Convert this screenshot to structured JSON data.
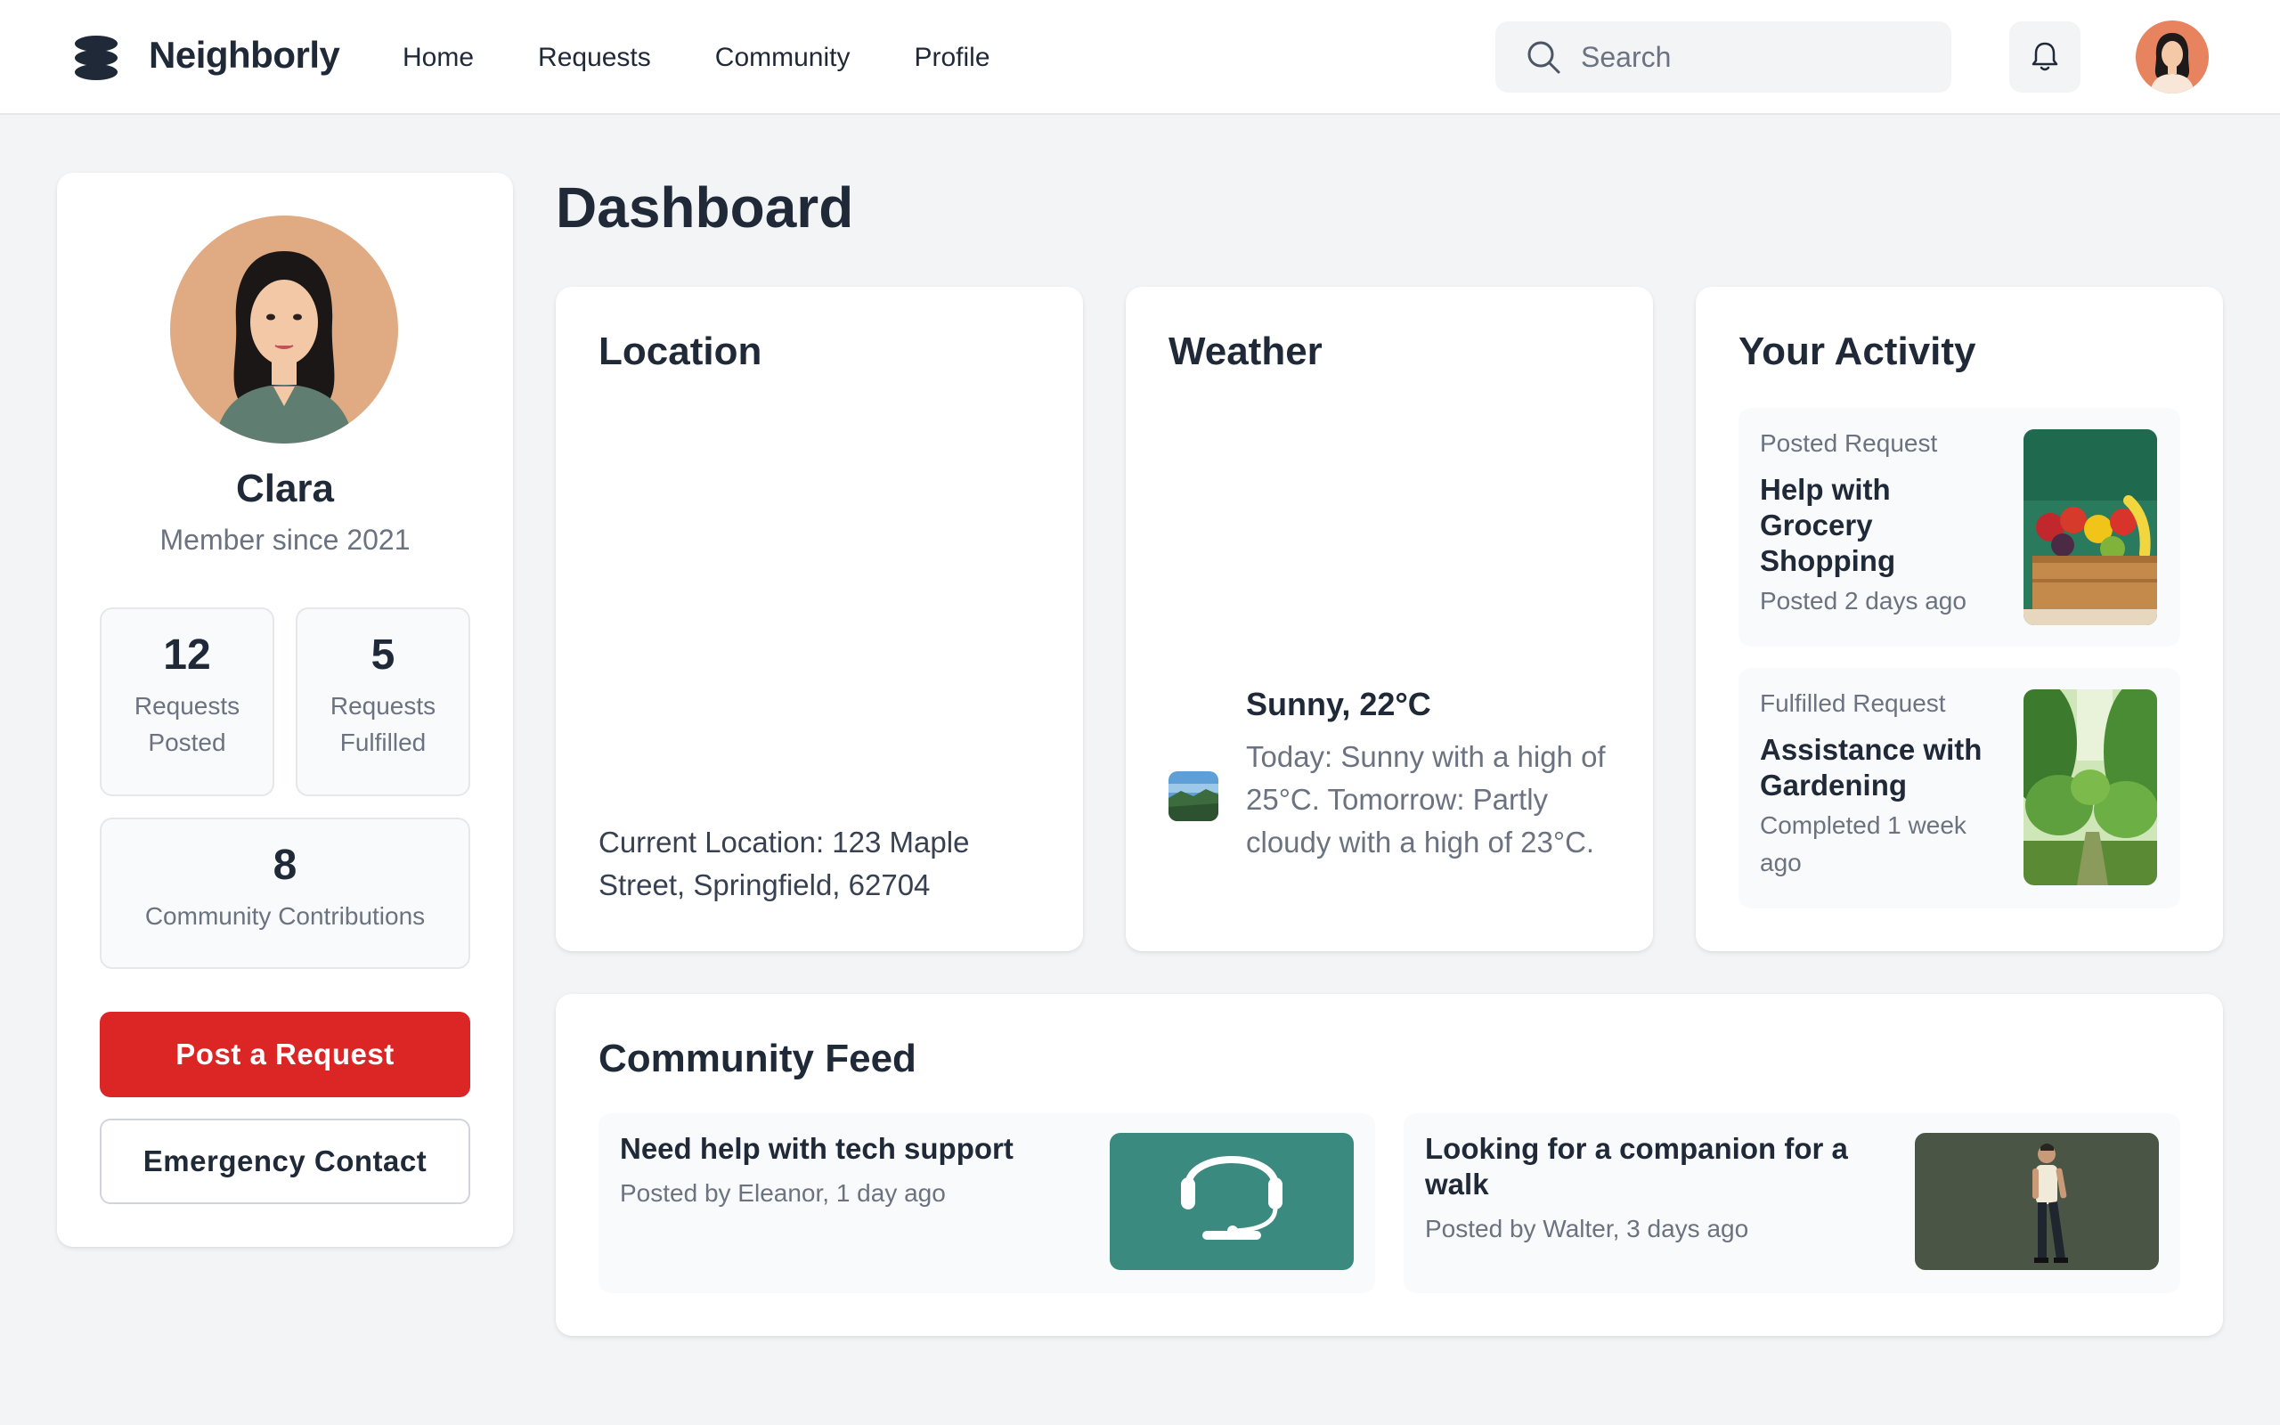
{
  "header": {
    "brand": "Neighborly",
    "nav": [
      "Home",
      "Requests",
      "Community",
      "Profile"
    ],
    "search_placeholder": "Search"
  },
  "profile": {
    "name": "Clara",
    "member_since": "Member since 2021",
    "stats": [
      {
        "value": "12",
        "label": "Requests Posted"
      },
      {
        "value": "5",
        "label": "Requests Fulfilled"
      },
      {
        "value": "8",
        "label": "Community Contributions"
      }
    ],
    "post_request_label": "Post a Request",
    "emergency_label": "Emergency Contact"
  },
  "main": {
    "title": "Dashboard",
    "location": {
      "title": "Location",
      "text": "Current Location: 123 Maple Street, Springfield, 62704"
    },
    "weather": {
      "title": "Weather",
      "headline": "Sunny, 22°C",
      "description": "Today: Sunny with a high of 25°C. Tomorrow: Partly cloudy with a high of 23°C."
    },
    "activity": {
      "title": "Your Activity",
      "items": [
        {
          "kind": "Posted Request",
          "title": "Help with Grocery Shopping",
          "meta": "Posted 2 days ago",
          "image": "grocery-crate"
        },
        {
          "kind": "Fulfilled Request",
          "title": "Assistance with Gardening",
          "meta": "Completed 1 week ago",
          "image": "garden"
        }
      ]
    },
    "feed": {
      "title": "Community Feed",
      "items": [
        {
          "title": "Need help with tech support",
          "meta": "Posted by Eleanor, 1 day ago",
          "image": "headset"
        },
        {
          "title": "Looking for a companion for a walk",
          "meta": "Posted by Walter, 3 days ago",
          "image": "walking-man"
        }
      ]
    }
  },
  "colors": {
    "accent_red": "#dc2626",
    "page_bg": "#f3f4f6",
    "feed_teal": "#3b8a80",
    "feed_olive": "#4a5545"
  }
}
